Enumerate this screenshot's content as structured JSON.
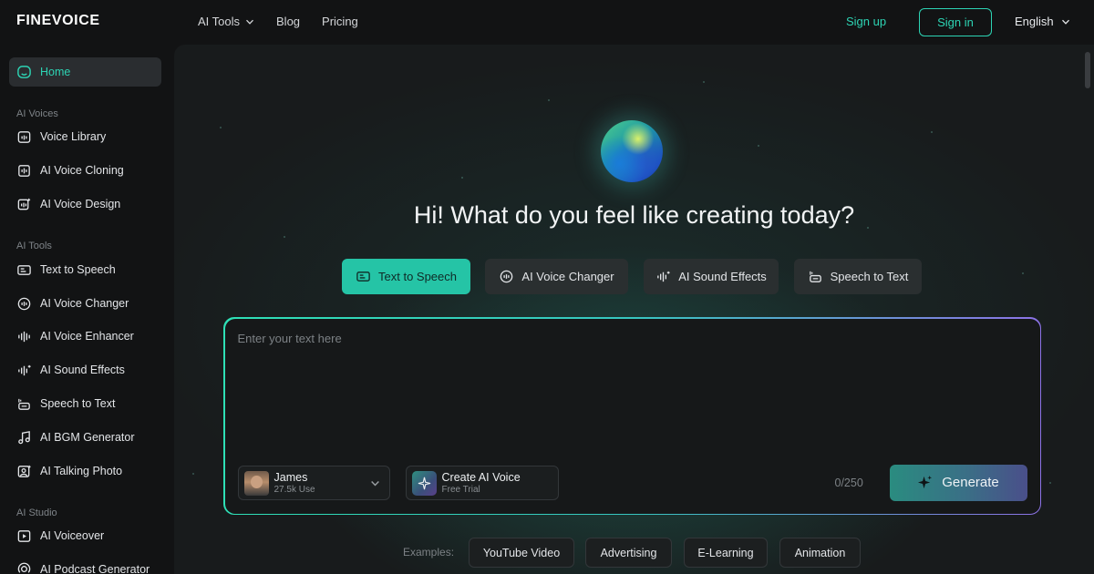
{
  "brand": {
    "logo": "FINEVOICE"
  },
  "nav": {
    "ai_tools": "AI Tools",
    "blog": "Blog",
    "pricing": "Pricing",
    "sign_up": "Sign up",
    "sign_in": "Sign in",
    "language": "English"
  },
  "sidebar": {
    "home": "Home",
    "sections": {
      "ai_voices": "AI Voices",
      "ai_tools": "AI Tools",
      "ai_studio": "AI Studio"
    },
    "voices": [
      "Voice Library",
      "AI Voice Cloning",
      "AI Voice Design"
    ],
    "tools": [
      "Text to Speech",
      "AI Voice Changer",
      "AI Voice Enhancer",
      "AI Sound Effects",
      "Speech to Text",
      "AI BGM Generator",
      "AI Talking Photo"
    ],
    "studio": [
      "AI Voiceover",
      "AI Podcast Generator"
    ]
  },
  "main": {
    "headline": "Hi! What do you feel like creating today?",
    "tabs": [
      "Text to Speech",
      "AI Voice Changer",
      "AI Sound Effects",
      "Speech to Text"
    ],
    "active_tab": "Text to Speech",
    "editor": {
      "placeholder": "Enter your text here",
      "voice_name": "James",
      "voice_uses": "27.5k Use",
      "create_voice_title": "Create AI Voice",
      "create_voice_sub": "Free Trial",
      "counter": "0/250",
      "generate": "Generate"
    },
    "examples": {
      "label": "Examples:",
      "items": [
        "YouTube Video",
        "Advertising",
        "E-Learning",
        "Animation"
      ]
    }
  },
  "colors": {
    "accent": "#2dd4b4",
    "active_tab": "#25c4a6",
    "background": "#121314",
    "panel": "#181b1c"
  }
}
